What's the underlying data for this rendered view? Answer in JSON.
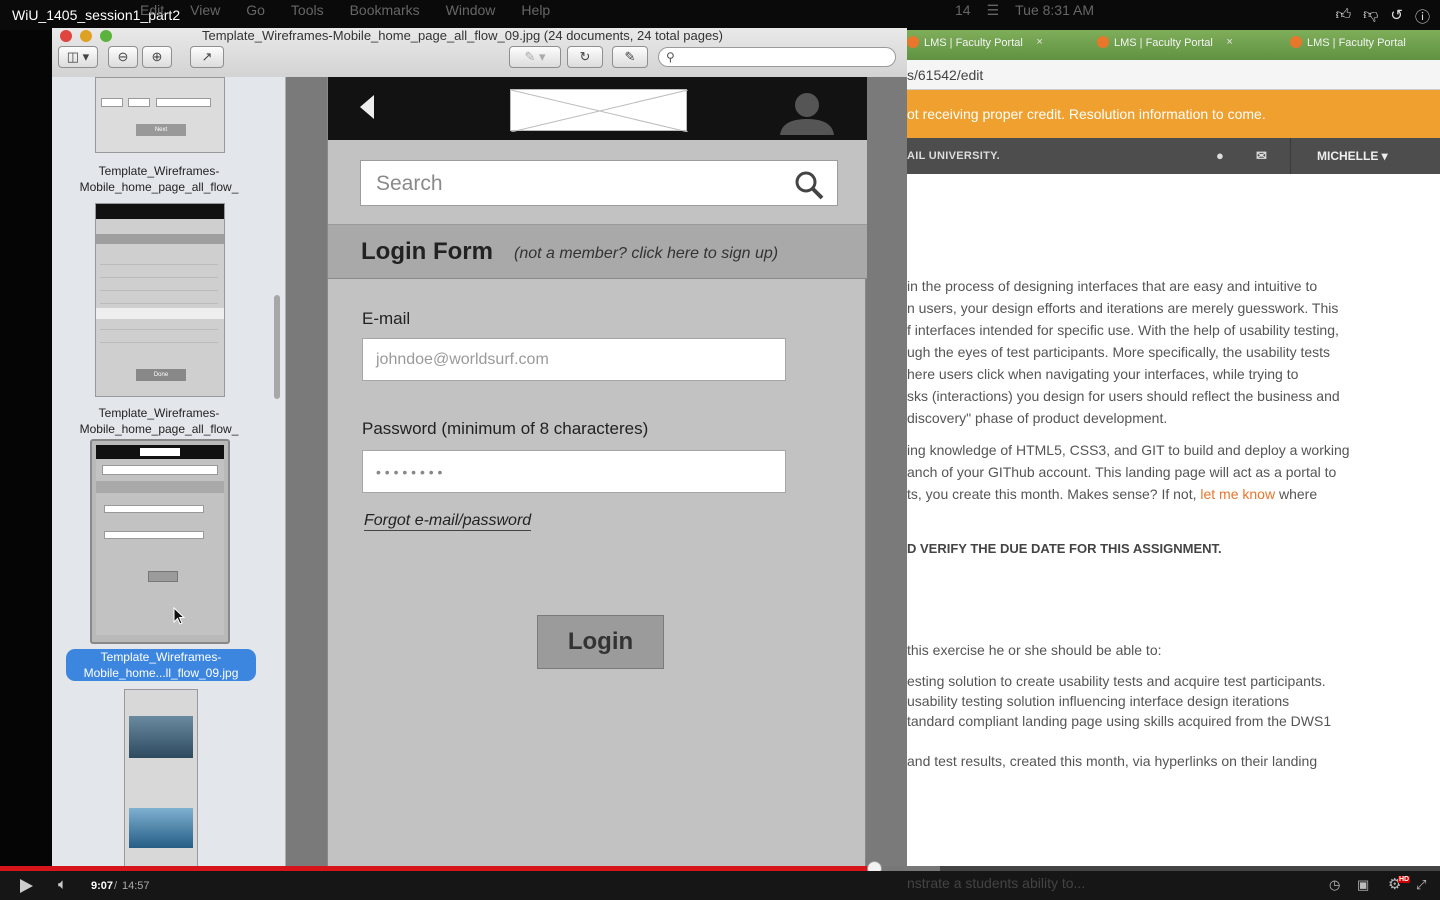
{
  "video": {
    "title": "WiU_1405_session1_part2",
    "time_current": "9:07",
    "time_separator": "/",
    "time_total": "14:57",
    "progress_fraction": 0.607,
    "buffered_fraction": 0.653,
    "hd_badge": "HD"
  },
  "mac_menu": {
    "items": [
      "Edit",
      "View",
      "Go",
      "Tools",
      "Bookmarks",
      "Window",
      "Help"
    ],
    "status_clock": "Tue 8:31 AM",
    "status_badge": "14"
  },
  "preview": {
    "window_title": "Template_Wireframes-Mobile_home_page_all_flow_09.jpg (24 documents, 24 total pages)",
    "sidebar": {
      "thumb_labels": [
        "Template_Wireframes-\nMobile_home_page_all_flow_",
        "Template_Wireframes-\nMobile_home_page_all_flow_",
        "Template_Wireframes-\nMobile_home...ll_flow_09.jpg"
      ],
      "thumb1_button": "Next",
      "thumb2_button": "Done"
    }
  },
  "wireframe": {
    "search_placeholder": "Search",
    "form_title": "Login Form",
    "form_subtitle": "(not a member? click here to sign up)",
    "email_label": "E-mail",
    "email_value": "johndoe@worldsurf.com",
    "password_label": "Password  (minimum of 8 characteres)",
    "password_mask": "• • • • • • • •",
    "forgot_link": "Forgot e-mail/password",
    "login_button": "Login"
  },
  "browser": {
    "tabs": [
      "LMS | Faculty Portal",
      "LMS | Faculty Portal",
      "LMS | Faculty Portal"
    ],
    "url": "s/61542/edit",
    "alert": "ot receiving proper credit. Resolution information to come.",
    "university": "AIL UNIVERSITY.",
    "user": "MICHELLE ▾",
    "paragraph1": [
      "in the process of designing interfaces that are easy and intuitive to",
      "n users, your design efforts and iterations are merely guesswork. This",
      "f interfaces intended for specific use. With the help of usability testing,",
      "ugh the eyes of test participants. More specifically, the usability tests",
      "here users click when navigating your interfaces, while trying to",
      "sks (interactions) you design for users should reflect the business and",
      "discovery\" phase of product development."
    ],
    "paragraph2": [
      "ing knowledge of HTML5, CSS3, and GIT to build and deploy a working",
      "anch of your GIThub account. This landing page will act as a portal to",
      "ts, you create this month. Makes sense? If not, "
    ],
    "link_text": "let me know",
    "link_after": " where",
    "due_note": "D VERIFY THE DUE DATE FOR THIS ASSIGNMENT.",
    "objectives_intro": "this exercise he or she should be able to:",
    "objectives": [
      "esting solution to create usability tests and acquire test participants.",
      "usability testing solution influencing interface design iterations",
      "tandard compliant landing page using skills acquired from the DWS1",
      "",
      "and test results, created this month, via hyperlinks on their landing"
    ],
    "bottom_faint": "nstrate a students ability to..."
  },
  "colors": {
    "progress_red": "#d8141b",
    "alert_orange": "#f0a02e",
    "selection_blue": "#3d86e0",
    "tab_green": "#6fa04b"
  }
}
